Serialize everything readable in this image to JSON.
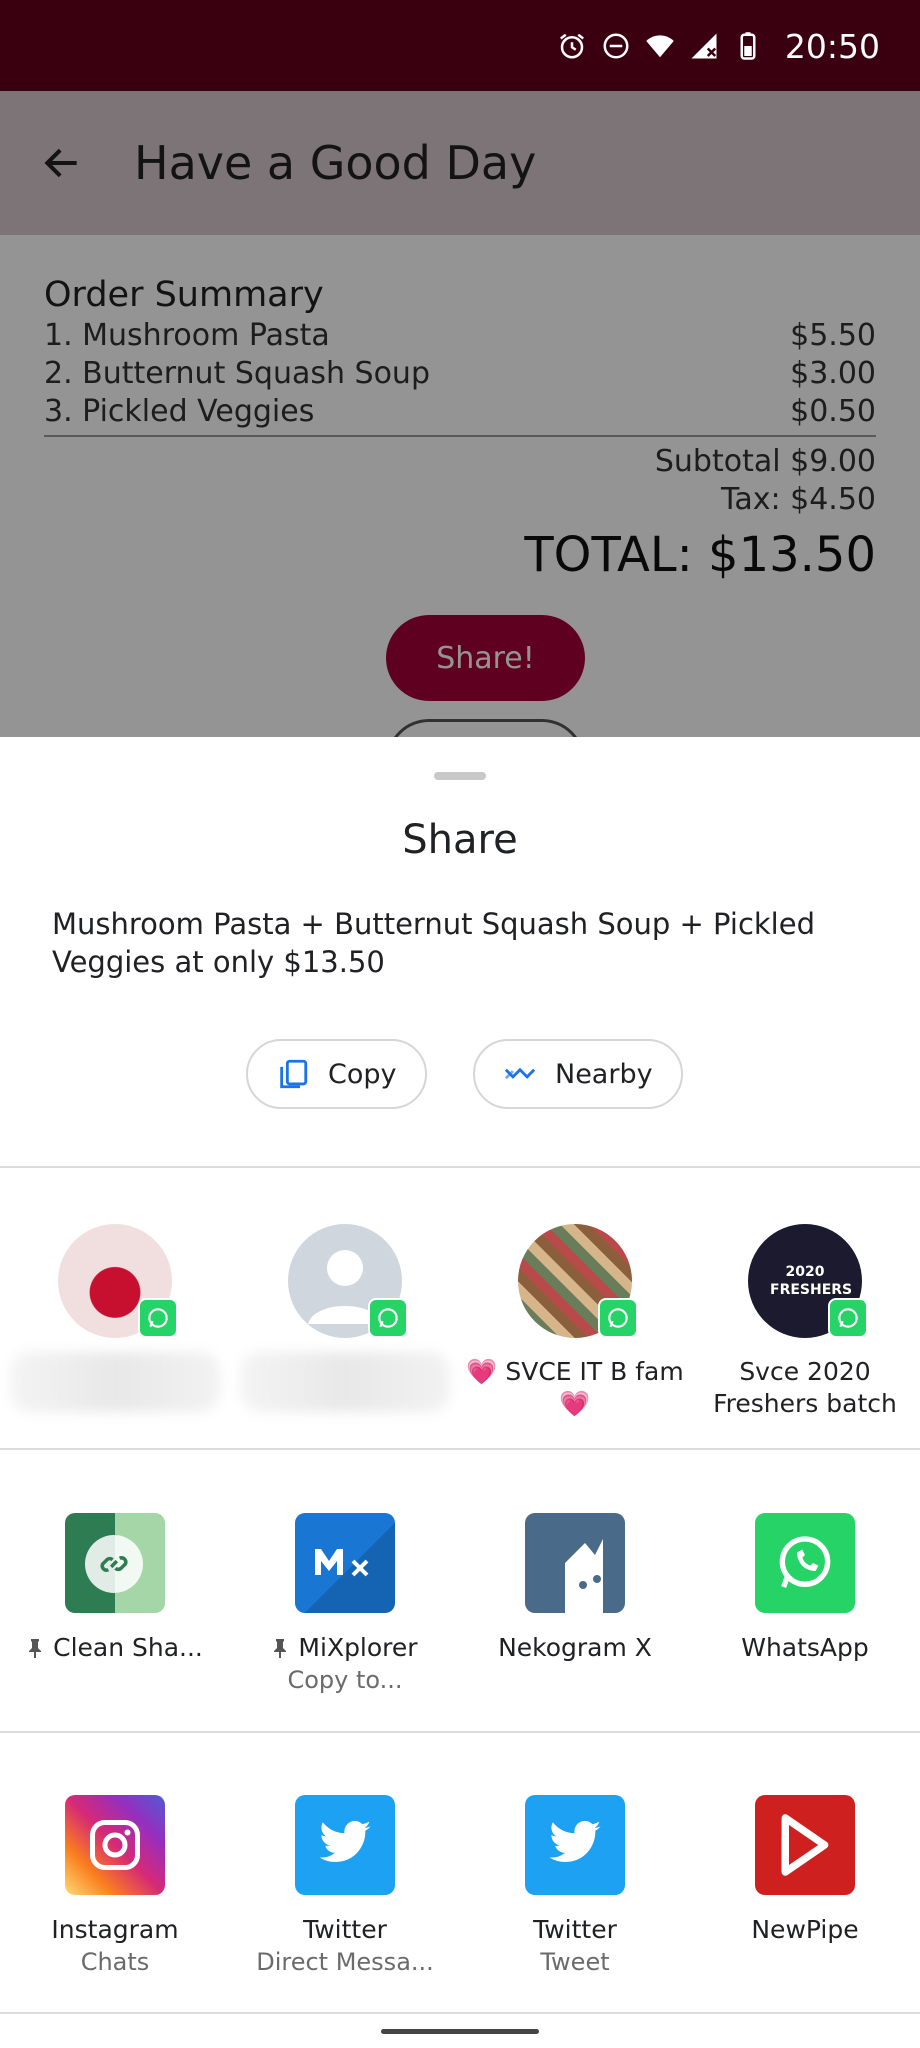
{
  "status_bar": {
    "time": "20:50",
    "icons": [
      "alarm-icon",
      "dnd-icon",
      "wifi-icon",
      "signal-icon",
      "battery-icon"
    ],
    "background": "#3a0010"
  },
  "app": {
    "title": "Have a Good Day",
    "order": {
      "heading": "Order Summary",
      "items": [
        {
          "name": "1. Mushroom Pasta",
          "price": "$5.50"
        },
        {
          "name": "2. Butternut Squash Soup",
          "price": "$3.00"
        },
        {
          "name": "3. Pickled Veggies",
          "price": "$0.50"
        }
      ],
      "subtotal": "Subtotal $9.00",
      "tax": "Tax: $4.50",
      "total": "TOTAL: $13.50"
    },
    "share_button": "Share!",
    "accent": "#a4003a"
  },
  "sheet": {
    "title": "Share",
    "text": "Mushroom Pasta + Butternut Squash Soup + Pickled Veggies at only $13.50",
    "copy_label": "Copy",
    "nearby_label": "Nearby",
    "contacts": [
      {
        "name": "",
        "avatar": "photo-avatar"
      },
      {
        "name": "",
        "avatar": "default-avatar"
      },
      {
        "name": "💗 SVCE IT B fam 💗",
        "avatar": "group-avatar"
      },
      {
        "name": "Svce 2020 Freshers batch",
        "avatar": "2020 FRESHERS"
      }
    ],
    "apps": [
      {
        "label": "Clean Sha...",
        "sub": "",
        "pinned": true,
        "icon": "clean-share-icon"
      },
      {
        "label": "MiXplorer",
        "sub": "Copy to...",
        "pinned": true,
        "icon": "mixplorer-icon"
      },
      {
        "label": "Nekogram X",
        "sub": "",
        "pinned": false,
        "icon": "nekogram-icon"
      },
      {
        "label": "WhatsApp",
        "sub": "",
        "pinned": false,
        "icon": "whatsapp-icon"
      },
      {
        "label": "Instagram",
        "sub": "Chats",
        "pinned": false,
        "icon": "instagram-icon"
      },
      {
        "label": "Twitter",
        "sub": "Direct Messa...",
        "pinned": false,
        "icon": "twitter-icon"
      },
      {
        "label": "Twitter",
        "sub": "Tweet",
        "pinned": false,
        "icon": "twitter-icon"
      },
      {
        "label": "NewPipe",
        "sub": "",
        "pinned": false,
        "icon": "newpipe-icon"
      }
    ]
  }
}
